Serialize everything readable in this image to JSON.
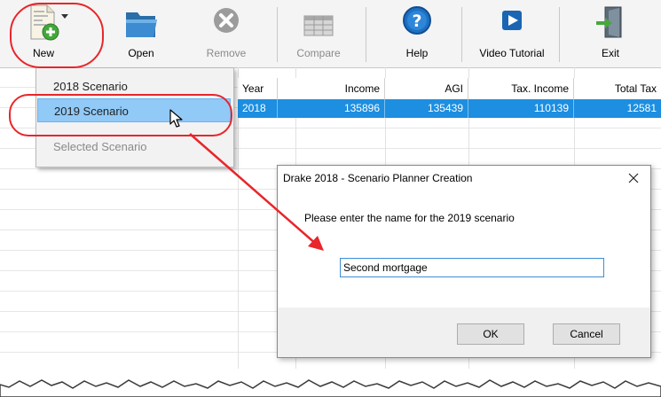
{
  "toolbar": {
    "buttons": [
      {
        "label": "New",
        "icon": "new-document-icon",
        "disabled": false
      },
      {
        "label": "Open",
        "icon": "folder-icon",
        "disabled": false
      },
      {
        "label": "Remove",
        "icon": "remove-x-icon",
        "disabled": true
      },
      {
        "label": "Compare",
        "icon": "compare-grid-icon",
        "disabled": true
      },
      {
        "label": "Help",
        "icon": "help-question-icon",
        "disabled": false
      },
      {
        "label": "Video Tutorial",
        "icon": "video-play-icon",
        "disabled": false
      },
      {
        "label": "Exit",
        "icon": "exit-door-icon",
        "disabled": false
      }
    ]
  },
  "new_menu": {
    "items": [
      {
        "label": "2018 Scenario",
        "state": "normal"
      },
      {
        "label": "2019 Scenario",
        "state": "highlighted"
      },
      {
        "label": "Selected Scenario",
        "state": "disabled"
      }
    ]
  },
  "grid": {
    "columns": [
      "Year",
      "Income",
      "AGI",
      "Tax. Income",
      "Total Tax"
    ],
    "rows": [
      {
        "selected": true,
        "cells": [
          "2018",
          "135896",
          "135439",
          "110139",
          "12581"
        ]
      }
    ]
  },
  "dialog": {
    "title": "Drake 2018 - Scenario Planner Creation",
    "prompt": "Please enter the name for the 2019 scenario",
    "input_value": "Second mortgage",
    "ok_label": "OK",
    "cancel_label": "Cancel"
  },
  "colors": {
    "selection": "#1d8ee0",
    "menu_highlight": "#91c9f7",
    "annotation": "#e8262b"
  }
}
